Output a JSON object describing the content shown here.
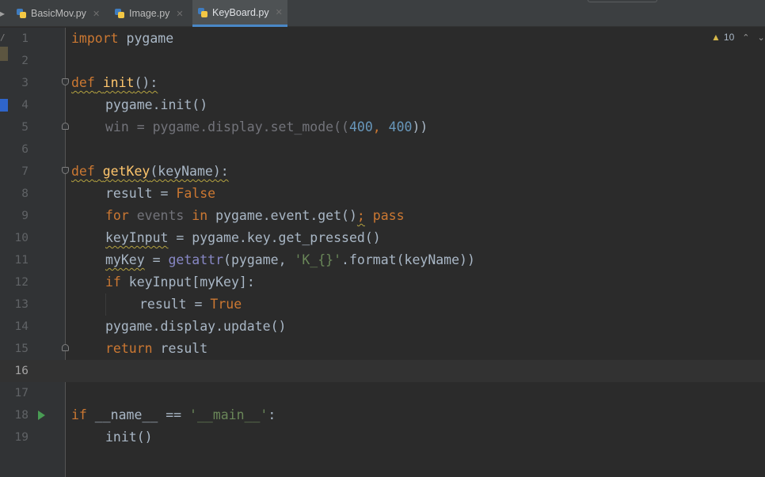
{
  "tabs": [
    {
      "label": "BasicMov.py",
      "active": false
    },
    {
      "label": "Image.py",
      "active": false
    },
    {
      "label": "KeyBoard.py",
      "active": true
    }
  ],
  "inspection": {
    "warning_count": "10"
  },
  "left_strip": {
    "path_fragment": "/"
  },
  "colors": {
    "background": "#2b2b2b",
    "gutter": "#313335",
    "keyword": "#cc7832",
    "function": "#ffc66d",
    "number": "#6897bb",
    "string": "#6a8759",
    "builtin": "#8888c6",
    "run_icon": "#499c54",
    "tab_underline": "#4a88c7"
  },
  "editor": {
    "current_line": 16,
    "lines": [
      {
        "n": "1"
      },
      {
        "n": "2"
      },
      {
        "n": "3"
      },
      {
        "n": "4"
      },
      {
        "n": "5"
      },
      {
        "n": "6"
      },
      {
        "n": "7"
      },
      {
        "n": "8"
      },
      {
        "n": "9"
      },
      {
        "n": "10"
      },
      {
        "n": "11"
      },
      {
        "n": "12"
      },
      {
        "n": "13"
      },
      {
        "n": "14"
      },
      {
        "n": "15"
      },
      {
        "n": "16"
      },
      {
        "n": "17"
      },
      {
        "n": "18"
      },
      {
        "n": "19"
      }
    ],
    "code": {
      "l1": {
        "kw": "import",
        "rest": " pygame"
      },
      "l3": {
        "kw": "def",
        "fn": "init",
        "rest": "():"
      },
      "l4": {
        "text": "pygame.init()"
      },
      "l5": {
        "a": "win = pygame.display.set_mode((",
        "n1": "400",
        "b": ", ",
        "n2": "400",
        "c": "))"
      },
      "l7": {
        "kw": "def",
        "fn": "getKey",
        "rest": "(keyName):"
      },
      "l8": {
        "a": "result = ",
        "kw": "False"
      },
      "l9": {
        "kw1": "for",
        "var": "events",
        "kw2": "in",
        "a": "pygame.event.get()",
        "semi": ";",
        "kw3": "pass"
      },
      "l10": {
        "var": "keyInput",
        "rest": " = pygame.key.get_pressed()"
      },
      "l11": {
        "var": "myKey",
        "a": " = ",
        "bi": "getattr",
        "b": "(pygame, ",
        "str": "'K_{}'",
        "c": ".format(keyName))"
      },
      "l12": {
        "kw": "if",
        "rest": " keyInput[myKey]:"
      },
      "l13": {
        "a": "result = ",
        "kw": "True"
      },
      "l14": {
        "text": "pygame.display.update()"
      },
      "l15": {
        "kw": "return",
        "rest": " result"
      },
      "l18": {
        "kw": "if",
        "a": " __name__ == ",
        "str": "'__main__'",
        "b": ":"
      },
      "l19": {
        "text": "init()"
      }
    }
  }
}
